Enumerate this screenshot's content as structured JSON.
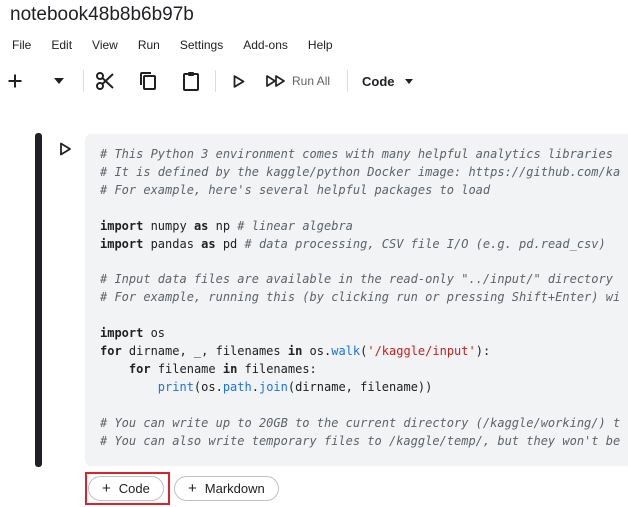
{
  "notebook": {
    "title": "notebook48b8b6b97b"
  },
  "menu": [
    "File",
    "Edit",
    "View",
    "Run",
    "Settings",
    "Add-ons",
    "Help"
  ],
  "toolbar": {
    "add_icon": "plus-icon",
    "dropdown_icon": "caret-down-icon",
    "cut_icon": "scissors-icon",
    "copy_icon": "copy-icon",
    "paste_icon": "clipboard-icon",
    "run_icon": "play-icon",
    "run_all_icon": "fast-forward-icon",
    "run_all_label": "Run All",
    "cell_type": "Code"
  },
  "cell": {
    "run_icon": "play-outline-icon",
    "lines": [
      [
        {
          "t": "# This Python 3 environment comes with many helpful analytics libraries",
          "c": "cm"
        }
      ],
      [
        {
          "t": "# It is defined by the kaggle/python Docker image: https://github.com/ka",
          "c": "cm"
        }
      ],
      [
        {
          "t": "# For example, here's several helpful packages to load",
          "c": "cm"
        }
      ],
      [],
      [
        {
          "t": "import",
          "c": "kw"
        },
        {
          "t": " numpy "
        },
        {
          "t": "as",
          "c": "kw"
        },
        {
          "t": " np "
        },
        {
          "t": "# linear algebra",
          "c": "cm"
        }
      ],
      [
        {
          "t": "import",
          "c": "kw"
        },
        {
          "t": " pandas "
        },
        {
          "t": "as",
          "c": "kw"
        },
        {
          "t": " pd "
        },
        {
          "t": "# data processing, CSV file I/O (e.g. pd.read_csv)",
          "c": "cm"
        }
      ],
      [],
      [
        {
          "t": "# Input data files are available in the read-only \"../input/\" directory",
          "c": "cm"
        }
      ],
      [
        {
          "t": "# For example, running this (by clicking run or pressing Shift+Enter) wi",
          "c": "cm"
        }
      ],
      [],
      [
        {
          "t": "import",
          "c": "kw"
        },
        {
          "t": " os"
        }
      ],
      [
        {
          "t": "for",
          "c": "kw"
        },
        {
          "t": " dirname, _, filenames "
        },
        {
          "t": "in",
          "c": "kw"
        },
        {
          "t": " os."
        },
        {
          "t": "walk",
          "c": "bi"
        },
        {
          "t": "("
        },
        {
          "t": "'/kaggle/input'",
          "c": "st"
        },
        {
          "t": "):"
        }
      ],
      [
        {
          "t": "    "
        },
        {
          "t": "for",
          "c": "kw"
        },
        {
          "t": " filename "
        },
        {
          "t": "in",
          "c": "kw"
        },
        {
          "t": " filenames:"
        }
      ],
      [
        {
          "t": "        "
        },
        {
          "t": "print",
          "c": "bi"
        },
        {
          "t": "(os."
        },
        {
          "t": "path",
          "c": "bi"
        },
        {
          "t": "."
        },
        {
          "t": "join",
          "c": "bi"
        },
        {
          "t": "(dirname, filename))"
        }
      ],
      [],
      [
        {
          "t": "# You can write up to 20GB to the current directory (/kaggle/working/) t",
          "c": "cm"
        }
      ],
      [
        {
          "t": "# You can also write temporary files to /kaggle/temp/, but they won't be",
          "c": "cm"
        }
      ]
    ]
  },
  "add_cell": {
    "code_label": "Code",
    "markdown_label": "Markdown",
    "plus": "+"
  }
}
